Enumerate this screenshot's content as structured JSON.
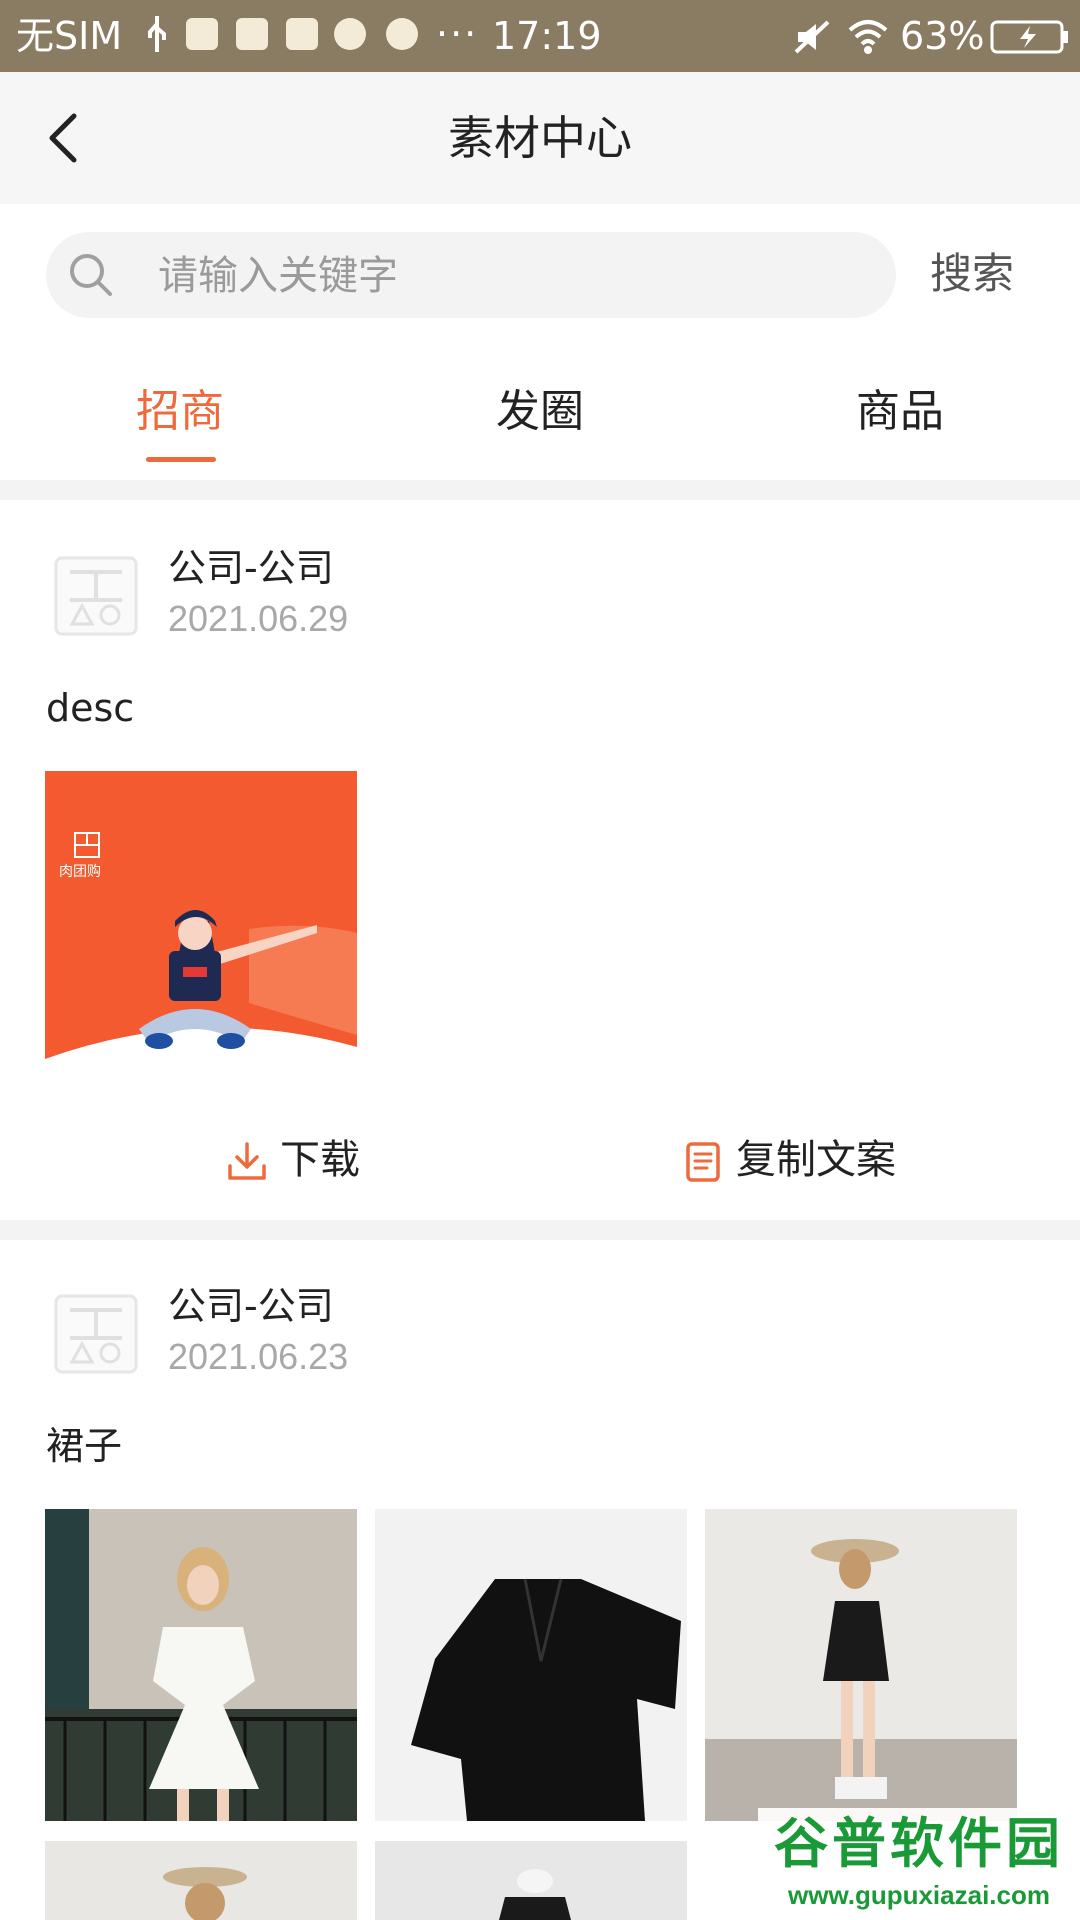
{
  "status_bar": {
    "carrier": "无SIM",
    "time": "17:19",
    "battery": "63%",
    "dots": "···"
  },
  "nav": {
    "title": "素材中心"
  },
  "search": {
    "placeholder": "请输入关键字",
    "button_label": "搜索"
  },
  "tabs": [
    {
      "label": "招商",
      "active": true
    },
    {
      "label": "发圈",
      "active": false
    },
    {
      "label": "商品",
      "active": false
    }
  ],
  "posts": [
    {
      "company": "公司-公司",
      "date": "2021.06.29",
      "desc": "desc",
      "actions": {
        "download": "下载",
        "copy": "复制文案"
      }
    },
    {
      "company": "公司-公司",
      "date": "2021.06.23",
      "desc": "裙子"
    }
  ],
  "poster_logo_text": "肉团购",
  "watermark": {
    "title": "谷普软件园",
    "url": "www.gupuxiazai.com"
  },
  "colors": {
    "accent": "#ee6a3c",
    "poster_bg": "#f35a30",
    "watermark": "#1a9a36"
  }
}
